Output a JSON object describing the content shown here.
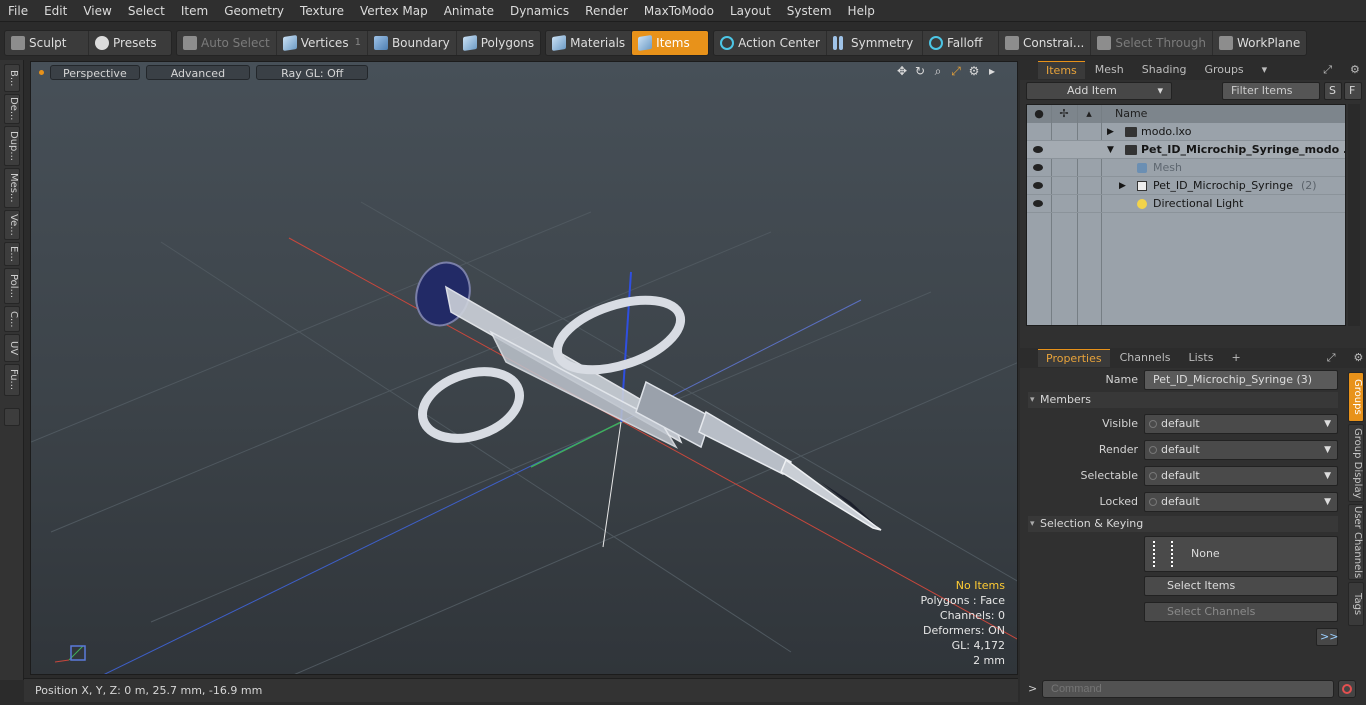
{
  "menu": [
    "File",
    "Edit",
    "View",
    "Select",
    "Item",
    "Geometry",
    "Texture",
    "Vertex Map",
    "Animate",
    "Dynamics",
    "Render",
    "MaxToModo",
    "Layout",
    "System",
    "Help"
  ],
  "toolbar": {
    "sculpt": "Sculpt",
    "presets": "Presets",
    "auto_select": "Auto Select",
    "vertices": "Vertices",
    "vertices_count": "1",
    "boundary": "Boundary",
    "polygons": "Polygons",
    "materials": "Materials",
    "items": "Items",
    "action_center": "Action Center",
    "symmetry": "Symmetry",
    "falloff": "Falloff",
    "constraints": "Constrai...",
    "select_through": "Select Through",
    "workplane": "WorkPlane"
  },
  "left_tabs": [
    "B...",
    "De...",
    "Dup...",
    "Mes...",
    "Ve...",
    "E...",
    "Pol...",
    "C...",
    "UV",
    "Fu..."
  ],
  "viewport": {
    "view": "Perspective",
    "shading": "Advanced",
    "raygl": "Ray GL: Off",
    "icons": [
      "move-view-icon",
      "rotate-view-icon",
      "zoom-view-icon",
      "maximize-icon",
      "gear-icon",
      "more-icon"
    ],
    "info": {
      "items": "No Items",
      "polygons": "Polygons : Face",
      "channels": "Channels: 0",
      "deformers": "Deformers: ON",
      "gl": "GL: 4,172",
      "scale": "2 mm"
    }
  },
  "status": {
    "position": "Position X, Y, Z:   0 m, 25.7 mm, -16.9 mm"
  },
  "items_panel": {
    "tabs": [
      "Items",
      "Mesh ...",
      "Shading",
      "Groups"
    ],
    "add_item": "Add Item",
    "filter": "Filter Items",
    "s": "S",
    "f": "F",
    "name_header": "Name",
    "rows": [
      {
        "label": "modo.lxo"
      },
      {
        "label": "Pet_ID_Microchip_Syringe_modo ..."
      },
      {
        "label": "Mesh"
      },
      {
        "label": "Pet_ID_Microchip_Syringe",
        "count": "(2)"
      },
      {
        "label": "Directional Light"
      }
    ]
  },
  "properties": {
    "tabs": [
      "Properties",
      "Channels",
      "Lists"
    ],
    "plus": "+",
    "name_label": "Name",
    "name_value": "Pet_ID_Microchip_Syringe (3)",
    "members": "Members",
    "visible_label": "Visible",
    "visible_value": "default",
    "render_label": "Render",
    "render_value": "default",
    "selectable_label": "Selectable",
    "selectable_value": "default",
    "locked_label": "Locked",
    "locked_value": "default",
    "sel_keying": "Selection & Keying",
    "none": "None",
    "select_items": "Select Items",
    "select_channels": "Select Channels",
    "more": ">>",
    "side_tabs": [
      "Groups",
      "Group Display",
      "User Channels",
      "Tags"
    ]
  },
  "command": {
    "prompt": ">",
    "placeholder": "Command"
  }
}
